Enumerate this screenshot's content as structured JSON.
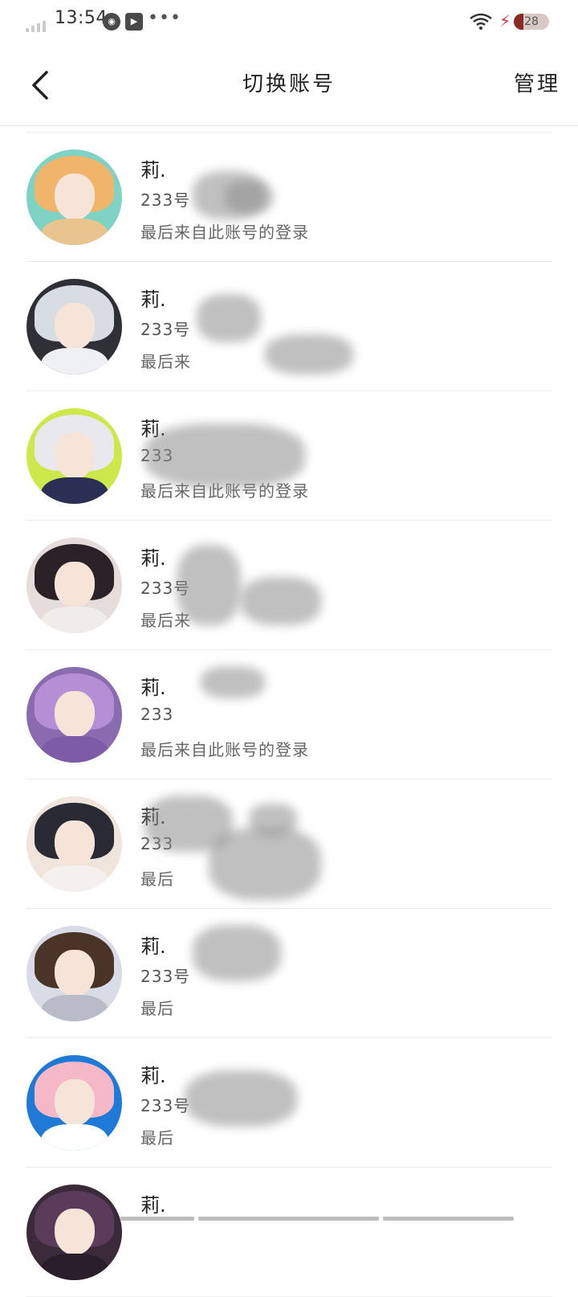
{
  "status_bar": {
    "time": "13:54",
    "battery": "28",
    "battery_level": 0.28,
    "icons": [
      "signal-icon",
      "soul-app-icon",
      "video-app-icon",
      "more-dots-icon",
      "wifi-icon",
      "charging-icon",
      "battery-icon"
    ]
  },
  "header": {
    "title": "切换账号",
    "manage_label": "管理"
  },
  "accounts": [
    {
      "nickname": "莉.",
      "uid": "233号",
      "last_login": "最后来自此账号的登录"
    },
    {
      "nickname": "莉.",
      "uid": "233号",
      "last_login": "最后来"
    },
    {
      "nickname": "莉.",
      "uid": "233",
      "last_login": "最后来自此账号的登录"
    },
    {
      "nickname": "莉.",
      "uid": "233号",
      "last_login": "最后来"
    },
    {
      "nickname": "莉.",
      "uid": "233",
      "last_login": "最后来自此账号的登录"
    },
    {
      "nickname": "莉.",
      "uid": "233",
      "last_login": "最后"
    },
    {
      "nickname": "莉.",
      "uid": "233号",
      "last_login": "最后"
    },
    {
      "nickname": "莉.",
      "uid": "233号",
      "last_login": "最后"
    },
    {
      "nickname": "莉.",
      "uid": "",
      "last_login": ""
    }
  ],
  "avatar_palettes": [
    {
      "bg": "#7fd3c4",
      "hair": "#f0b46a",
      "body": "#e9c48e"
    },
    {
      "bg": "#2f2f36",
      "hair": "#d8dde3",
      "body": "#eef0f3"
    },
    {
      "bg": "#cde84a",
      "hair": "#e8e8ee",
      "body": "#2c2f55"
    },
    {
      "bg": "#e7dcdc",
      "hair": "#2a2226",
      "body": "#f0ecea"
    },
    {
      "bg": "#8a6bb0",
      "hair": "#b48fd6",
      "body": "#7e5ba6"
    },
    {
      "bg": "#efe5dc",
      "hair": "#2a2a35",
      "body": "#f4f0f0"
    },
    {
      "bg": "#d9dce6",
      "hair": "#4a3428",
      "body": "#b9bcc8"
    },
    {
      "bg": "#1e7ad6",
      "hair": "#f5b8c6",
      "body": "#ffffff"
    },
    {
      "bg": "#3a2a3a",
      "hair": "#5a3c5a",
      "body": "#2a1e2a"
    }
  ]
}
